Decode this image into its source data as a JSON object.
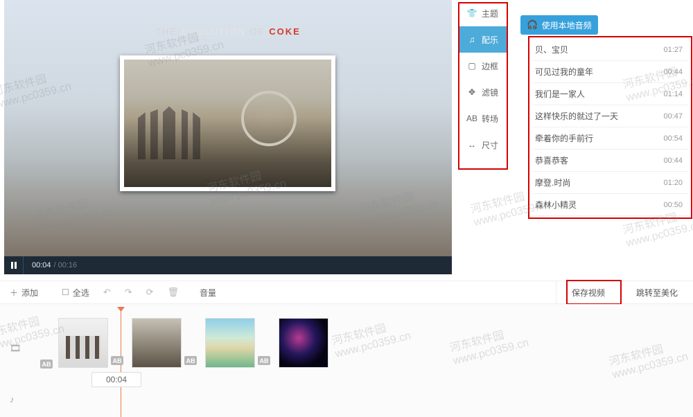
{
  "preview": {
    "heading_pre": "THE",
    "heading_mid": "EVOLUTION",
    "heading_of": "OF",
    "heading_brand": "COKE"
  },
  "playback": {
    "current": "00:04",
    "total": "/ 00:16"
  },
  "tabs": [
    {
      "label": "主题",
      "icon": "shirt-icon"
    },
    {
      "label": "配乐",
      "icon": "music-icon",
      "active": true
    },
    {
      "label": "边框",
      "icon": "border-icon"
    },
    {
      "label": "滤镜",
      "icon": "filter-icon"
    },
    {
      "label": "转场",
      "icon": "transition-icon"
    },
    {
      "label": "尺寸",
      "icon": "size-icon"
    }
  ],
  "local_audio_label": "使用本地音频",
  "music": [
    {
      "title": "贝、宝贝",
      "dur": "01:27"
    },
    {
      "title": "可见过我的童年",
      "dur": "00:44"
    },
    {
      "title": "我们是一家人",
      "dur": "01:14"
    },
    {
      "title": "这样快乐的就过了一天",
      "dur": "00:47"
    },
    {
      "title": "牵着你的手前行",
      "dur": "00:54"
    },
    {
      "title": "恭喜恭客",
      "dur": "00:44"
    },
    {
      "title": "摩登.时尚",
      "dur": "01:20"
    },
    {
      "title": "森林小精灵",
      "dur": "00:50"
    }
  ],
  "toolbar": {
    "add": "添加",
    "select_all": "全选",
    "volume": "音量",
    "save": "保存视频",
    "jump": "跳转至美化"
  },
  "timeline": {
    "ab": "AB",
    "tip": "00:04"
  },
  "watermark": {
    "line1": "河东软件园",
    "line2": "www.pc0359.cn"
  }
}
